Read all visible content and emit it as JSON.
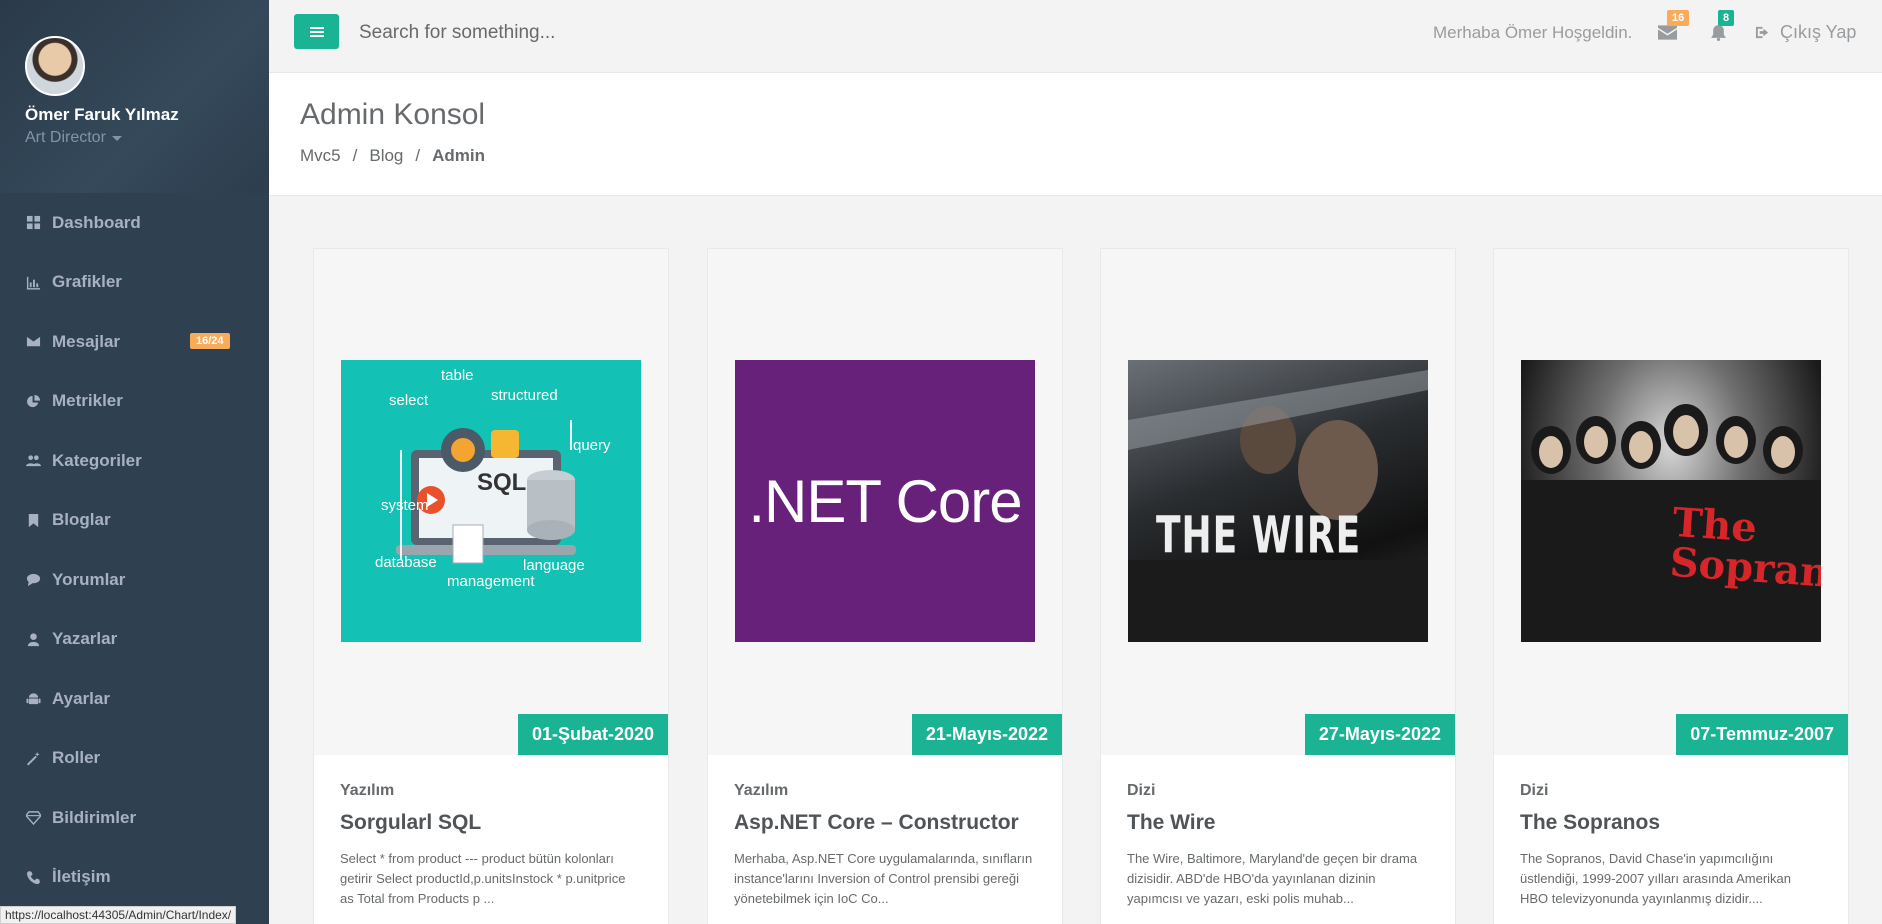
{
  "sidebar": {
    "profile": {
      "name": "Ömer Faruk Yılmaz",
      "role": "Art Director"
    },
    "items": [
      {
        "label": "Dashboard",
        "icon": "th-large-icon"
      },
      {
        "label": "Grafikler",
        "icon": "bar-chart-icon"
      },
      {
        "label": "Mesajlar",
        "icon": "envelope-icon",
        "badge": "16/24"
      },
      {
        "label": "Metrikler",
        "icon": "pie-chart-icon"
      },
      {
        "label": "Kategoriler",
        "icon": "users-icon"
      },
      {
        "label": "Bloglar",
        "icon": "bookmark-icon"
      },
      {
        "label": "Yorumlar",
        "icon": "comment-icon"
      },
      {
        "label": "Yazarlar",
        "icon": "user-icon"
      },
      {
        "label": "Ayarlar",
        "icon": "android-icon"
      },
      {
        "label": "Roller",
        "icon": "magic-icon"
      },
      {
        "label": "Bildirimler",
        "icon": "diamond-icon"
      },
      {
        "label": "İletişim",
        "icon": "phone-icon"
      }
    ]
  },
  "topbar": {
    "search_placeholder": "Search for something...",
    "welcome": "Merhaba Ömer Hoşgeldin.",
    "mail_count": "16",
    "bell_count": "8",
    "logout_label": "Çıkış Yap"
  },
  "heading": {
    "title": "Admin Konsol",
    "breadcrumb": [
      "Mvc5",
      "Blog",
      "Admin"
    ]
  },
  "cards": [
    {
      "date": "01-Şubat-2020",
      "category": "Yazılım",
      "title": "Sorgularl SQL",
      "text": "Select * from product --- product bütün kolonları getirir Select productId,p.unitsInstock * p.unitprice as Total from Products p ...",
      "image": "sql-illustration"
    },
    {
      "date": "21-Mayıs-2022",
      "category": "Yazılım",
      "title": "Asp.NET Core – Constructor",
      "text": "Merhaba, Asp.NET Core uygulamalarında, sınıfların instance'larını Inversion of Control prensibi gereği yönetebilmek için IoC Co...",
      "image": "net-core-logo"
    },
    {
      "date": "27-Mayıs-2022",
      "category": "Dizi",
      "title": "The Wire",
      "text": "The Wire, Baltimore, Maryland'de geçen bir drama dizisidir. ABD'de HBO'da yayınlanan dizinin yapımcısı ve yazarı, eski polis muhab...",
      "image": "the-wire-poster"
    },
    {
      "date": "07-Temmuz-2007",
      "category": "Dizi",
      "title": "The Sopranos",
      "text": "The Sopranos, David Chase'in yapımcılığını üstlendiği, 1999-2007 yılları arasında Amerikan HBO televizyonunda yayınlanmış dizidir....",
      "image": "sopranos-poster"
    }
  ],
  "images": {
    "sql_words": [
      "table",
      "select",
      "structured",
      "query",
      "system",
      "database",
      "management",
      "language",
      "SQL"
    ],
    "net_logo": ".NET Core",
    "wire_logo": "THE WIRE",
    "sopranos_logo": "The Sopranos"
  },
  "statusbar": {
    "url": "https://localhost:44305/Admin/Chart/Index/"
  },
  "colors": {
    "accent": "#1ab394",
    "sidebar": "#2f4050",
    "badge_warning": "#f8ac59"
  }
}
